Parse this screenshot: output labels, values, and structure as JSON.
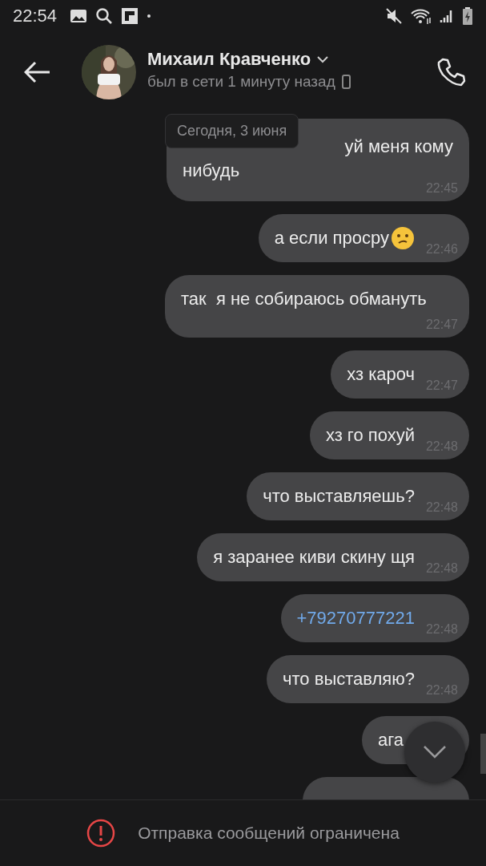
{
  "status_bar": {
    "time": "22:54"
  },
  "header": {
    "name": "Михаил Кравченко",
    "status": "был в сети 1 минуту назад"
  },
  "date_pill": "Сегодня, 3 июня",
  "messages": [
    {
      "kind": "partial",
      "lines": [
        "уй меня кому",
        "нибудь"
      ],
      "time": "22:45"
    },
    {
      "kind": "text",
      "text": "а если просру",
      "emoji": true,
      "time": "22:46"
    },
    {
      "kind": "text",
      "text": "так  я не собираюсь обмануть",
      "time": "22:47"
    },
    {
      "kind": "text",
      "text": "хз кароч",
      "time": "22:47"
    },
    {
      "kind": "text",
      "text": "хз го похуй",
      "time": "22:48"
    },
    {
      "kind": "text",
      "text": "что выставляешь?",
      "time": "22:48"
    },
    {
      "kind": "text",
      "text": "я заранее киви скину щя",
      "time": "22:48"
    },
    {
      "kind": "link",
      "text": "+79270777221",
      "time": "22:48"
    },
    {
      "kind": "text",
      "text": "что выставляю?",
      "time": "22:48"
    },
    {
      "kind": "text",
      "text": "ага"
    },
    {
      "kind": "cut"
    }
  ],
  "notice": "Отправка сообщений ограничена"
}
